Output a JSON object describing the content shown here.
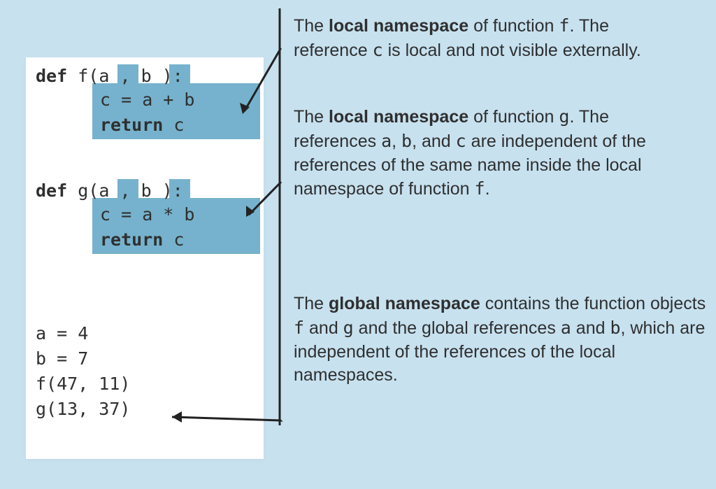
{
  "code": {
    "def_f": "def",
    "f_sig_a": "f(",
    "f_param_a": "a",
    "f_comma": ",",
    "f_param_b": "b",
    "f_sig_end": "):",
    "f_body1": "c = a + b",
    "f_return": "return",
    "f_return_var": " c",
    "def_g": "def",
    "g_sig_a": "g(",
    "g_param_a": "a",
    "g_comma": ",",
    "g_param_b": "b",
    "g_sig_end": "):",
    "g_body1": "c = a * b",
    "g_return": "return",
    "g_return_var": " c",
    "global_a": "a = 4",
    "global_b": "b = 7",
    "call_f": "f(47, 11)",
    "call_g": "g(13, 37)"
  },
  "anno": {
    "p1_pre": "The ",
    "p1_bold": "local namespace",
    "p1_post_a": " of function ",
    "p1_code_f": "f",
    "p1_post_b": ". The reference ",
    "p1_code_c": "c",
    "p1_post_c": " is local and not visible externally.",
    "p2_pre": "The ",
    "p2_bold": "local namespace",
    "p2_post_a": " of function ",
    "p2_code_g": "g",
    "p2_post_b": ". The references ",
    "p2_code_a": "a",
    "p2_comma1": ", ",
    "p2_code_b": "b",
    "p2_comma2": ", and ",
    "p2_code_c": "c",
    "p2_post_c": " are independent of the references of the same name inside the local namespace of function ",
    "p2_code_f": "f",
    "p2_period": ".",
    "p3_pre": "The ",
    "p3_bold": "global namespace",
    "p3_post_a": " contains the function objects ",
    "p3_code_f": "f",
    "p3_and": " and ",
    "p3_code_g": "g",
    "p3_post_b": " and the global references ",
    "p3_code_a": "a",
    "p3_and2": " and ",
    "p3_code_b": "b",
    "p3_post_c": ", which are independent of the references of the local namespaces."
  }
}
